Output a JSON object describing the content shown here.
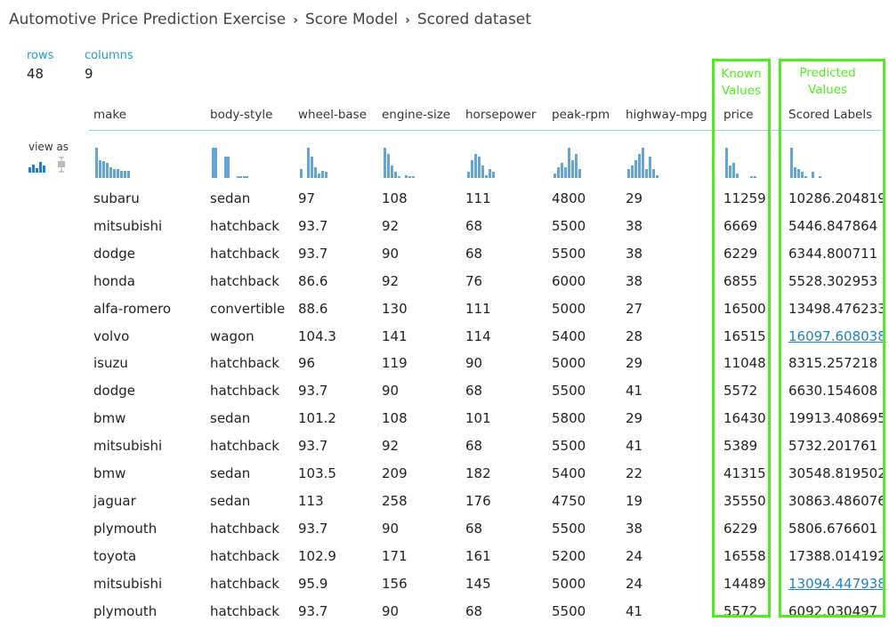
{
  "breadcrumb": [
    "Automotive Price Prediction Exercise",
    "Score Model",
    "Scored dataset"
  ],
  "stats": {
    "rows_label": "rows",
    "rows_value": "48",
    "columns_label": "columns",
    "columns_value": "9"
  },
  "view_as_label": "view as",
  "icons": {
    "histogram": "histogram-icon",
    "boxplot": "boxplot-icon"
  },
  "annotations": {
    "known": [
      "Known",
      "Values"
    ],
    "predicted": [
      "Predicted",
      "Values"
    ],
    "color": "#4ded1f"
  },
  "columns": [
    "make",
    "body-style",
    "wheel-base",
    "engine-size",
    "horsepower",
    "peak-rpm",
    "highway-mpg",
    "price",
    "Scored Labels"
  ],
  "histograms": [
    [
      1,
      0.6,
      0.55,
      0.5,
      0.35,
      0.3,
      0.3,
      0.25,
      0.25,
      0.25
    ],
    [
      1,
      0,
      0.7,
      0,
      0.05,
      0.05
    ],
    [
      0.3,
      0,
      1,
      0.7,
      0.35,
      0.15,
      0.25,
      0.2
    ],
    [
      1,
      0.8,
      0.4,
      0.2,
      0.05,
      0,
      0.1,
      0.05,
      0.05
    ],
    [
      0.2,
      0.6,
      0.8,
      0.7,
      0.4,
      0.1,
      0.3,
      0.2
    ],
    [
      0.15,
      0.35,
      0.5,
      0.35,
      1,
      0.6,
      0.8,
      0.3
    ],
    [
      0.3,
      0.4,
      0.6,
      0.8,
      1,
      0.3,
      0.7,
      0.3,
      0.1
    ],
    [
      1,
      0.4,
      0.5,
      0.15,
      0,
      0,
      0,
      0.05,
      0.05
    ],
    [
      1,
      0.35,
      0.3,
      0.2,
      0.05,
      0,
      0.2,
      0,
      0.05
    ]
  ],
  "link_color": "#1e7fd0",
  "rows": [
    [
      "subaru",
      "sedan",
      "97",
      "108",
      "111",
      "4800",
      "29",
      "11259",
      "10286.204819"
    ],
    [
      "mitsubishi",
      "hatchback",
      "93.7",
      "92",
      "68",
      "5500",
      "38",
      "6669",
      "5446.847864"
    ],
    [
      "dodge",
      "hatchback",
      "93.7",
      "90",
      "68",
      "5500",
      "38",
      "6229",
      "6344.800711"
    ],
    [
      "honda",
      "hatchback",
      "86.6",
      "92",
      "76",
      "6000",
      "38",
      "6855",
      "5528.302953"
    ],
    [
      "alfa-romero",
      "convertible",
      "88.6",
      "130",
      "111",
      "5000",
      "27",
      "16500",
      "13498.476233"
    ],
    [
      "volvo",
      "wagon",
      "104.3",
      "141",
      "114",
      "5400",
      "28",
      "16515",
      "16097.608038"
    ],
    [
      "isuzu",
      "hatchback",
      "96",
      "119",
      "90",
      "5000",
      "29",
      "11048",
      "8315.257218"
    ],
    [
      "dodge",
      "hatchback",
      "93.7",
      "90",
      "68",
      "5500",
      "41",
      "5572",
      "6630.154608"
    ],
    [
      "bmw",
      "sedan",
      "101.2",
      "108",
      "101",
      "5800",
      "29",
      "16430",
      "19913.408695"
    ],
    [
      "mitsubishi",
      "hatchback",
      "93.7",
      "92",
      "68",
      "5500",
      "41",
      "5389",
      "5732.201761"
    ],
    [
      "bmw",
      "sedan",
      "103.5",
      "209",
      "182",
      "5400",
      "22",
      "41315",
      "30548.819502"
    ],
    [
      "jaguar",
      "sedan",
      "113",
      "258",
      "176",
      "4750",
      "19",
      "35550",
      "30863.486076"
    ],
    [
      "plymouth",
      "hatchback",
      "93.7",
      "90",
      "68",
      "5500",
      "38",
      "6229",
      "5806.676601"
    ],
    [
      "toyota",
      "hatchback",
      "102.9",
      "171",
      "161",
      "5200",
      "24",
      "16558",
      "17388.014192"
    ],
    [
      "mitsubishi",
      "hatchback",
      "95.9",
      "156",
      "145",
      "5000",
      "24",
      "14489",
      "13094.447938"
    ],
    [
      "plymouth",
      "hatchback",
      "93.7",
      "90",
      "68",
      "5500",
      "41",
      "5572",
      "6092.030497"
    ]
  ],
  "link_rows": [
    5,
    14
  ]
}
